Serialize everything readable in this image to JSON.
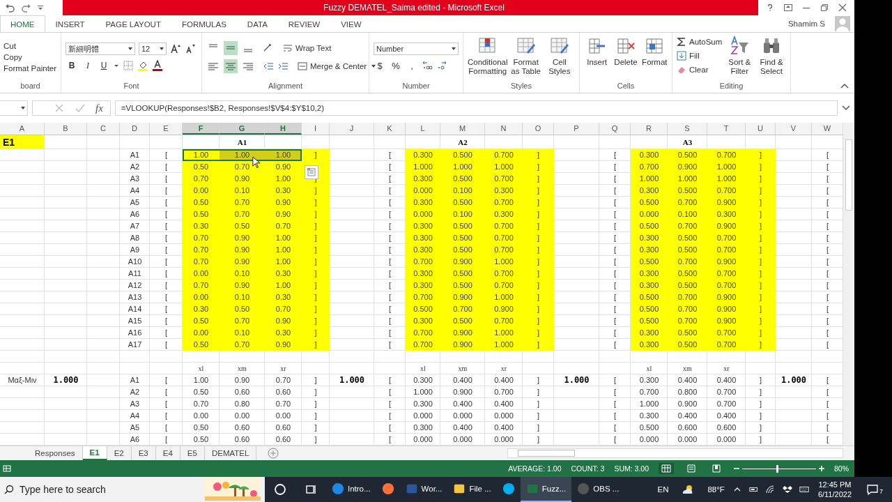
{
  "title_bar": {
    "title": "Fuzzy DEMATEL_Saima edited - Microsoft Excel"
  },
  "ribbon_tabs": [
    {
      "label": "HOME",
      "selected": true
    },
    {
      "label": "INSERT",
      "selected": false
    },
    {
      "label": "PAGE LAYOUT",
      "selected": false
    },
    {
      "label": "FORMULAS",
      "selected": false
    },
    {
      "label": "DATA",
      "selected": false
    },
    {
      "label": "REVIEW",
      "selected": false
    },
    {
      "label": "VIEW",
      "selected": false
    }
  ],
  "account": {
    "name": "Shamim S"
  },
  "ribbon": {
    "clipboard": {
      "label": "board",
      "items": [
        "Cut",
        "Copy",
        "Format Painter"
      ]
    },
    "font": {
      "label": "Font",
      "name": "新細明體",
      "size": "12",
      "styles": [
        "B",
        "I",
        "U"
      ]
    },
    "alignment": {
      "label": "Alignment",
      "vertical": [
        {
          "selected": false
        },
        {
          "selected": true
        },
        {
          "selected": false
        }
      ],
      "horizontal": [
        {
          "selected": false
        },
        {
          "selected": true
        },
        {
          "selected": false
        }
      ],
      "wrap": "Wrap Text",
      "merge": "Merge & Center"
    },
    "number": {
      "label": "Number",
      "format": "Number",
      "symbols": [
        "$",
        "%",
        ","
      ]
    },
    "styles": {
      "label": "Styles",
      "buttons": [
        "Conditional Formatting",
        "Format as Table",
        "Cell Styles"
      ]
    },
    "cells": {
      "label": "Cells",
      "buttons": [
        "Insert",
        "Delete",
        "Format"
      ]
    },
    "editing": {
      "label": "Editing",
      "small": [
        "AutoSum",
        "Fill",
        "Clear"
      ],
      "big": [
        "Sort & Filter",
        "Find & Select"
      ]
    }
  },
  "formula_bar": {
    "fx": "fx",
    "formula": "=VLOOKUP(Responses!$B2, Responses!$V$4:$Y$10,2)"
  },
  "sheet": {
    "columns": [
      {
        "label": "A",
        "band": false,
        "selected": false
      },
      {
        "label": "B",
        "band": false,
        "selected": false
      },
      {
        "label": "C",
        "band": false,
        "selected": false
      },
      {
        "label": "D",
        "band": false,
        "selected": false
      },
      {
        "label": "E",
        "band": false,
        "selected": false
      },
      {
        "label": "F",
        "band": true,
        "selected": true
      },
      {
        "label": "G",
        "band": true,
        "selected": true
      },
      {
        "label": "H",
        "band": true,
        "selected": true
      },
      {
        "label": "I",
        "band": true,
        "selected": false
      },
      {
        "label": "J",
        "band": false,
        "selected": false
      },
      {
        "label": "K",
        "band": false,
        "selected": false
      },
      {
        "label": "L",
        "band": true,
        "selected": false
      },
      {
        "label": "M",
        "band": true,
        "selected": false
      },
      {
        "label": "N",
        "band": true,
        "selected": false
      },
      {
        "label": "O",
        "band": true,
        "selected": false
      },
      {
        "label": "P",
        "band": false,
        "selected": false
      },
      {
        "label": "Q",
        "band": false,
        "selected": false
      },
      {
        "label": "R",
        "band": true,
        "selected": false
      },
      {
        "label": "S",
        "band": true,
        "selected": false
      },
      {
        "label": "T",
        "band": true,
        "selected": false
      },
      {
        "label": "U",
        "band": true,
        "selected": false
      },
      {
        "label": "V",
        "band": false,
        "selected": false
      },
      {
        "label": "W",
        "band": false,
        "selected": false
      }
    ],
    "rows": [
      {
        "kind": "title",
        "selected": false,
        "cells": [
          {
            "text": "E1",
            "filled": true
          },
          null,
          null,
          null,
          null,
          null,
          {
            "text": "A1",
            "filled": false
          },
          null,
          null,
          null,
          null,
          null,
          {
            "text": "A2",
            "filled": false
          },
          null,
          null,
          null,
          null,
          null,
          {
            "text": "A3",
            "filled": false
          },
          null,
          null,
          null,
          null
        ]
      },
      {
        "kind": "data",
        "selected": true,
        "cells": [
          null,
          null,
          null,
          "A1",
          "[",
          "1.00",
          "1.00",
          "1.00",
          "]",
          null,
          "[",
          "0.300",
          "0.500",
          "0.700",
          "]",
          null,
          "[",
          "0.300",
          "0.500",
          "0.700",
          "]",
          null,
          "["
        ]
      },
      {
        "kind": "data",
        "selected": false,
        "cells": [
          null,
          null,
          null,
          "A2",
          "[",
          "0.50",
          "0.70",
          "0.90",
          null,
          null,
          "[",
          "1.000",
          "1.000",
          "1.000",
          "]",
          null,
          "[",
          "0.700",
          "0.900",
          "1.000",
          "]",
          null,
          "["
        ]
      },
      {
        "kind": "data",
        "selected": false,
        "cells": [
          null,
          null,
          null,
          "A3",
          "[",
          "0.70",
          "0.90",
          "1.00",
          "]",
          null,
          "[",
          "0.300",
          "0.500",
          "0.700",
          "]",
          null,
          "[",
          "1.000",
          "1.000",
          "1.000",
          "]",
          null,
          "["
        ]
      },
      {
        "kind": "data",
        "selected": false,
        "cells": [
          null,
          null,
          null,
          "A4",
          "[",
          "0.00",
          "0.10",
          "0.30",
          "]",
          null,
          "[",
          "0.000",
          "0.100",
          "0.300",
          "]",
          null,
          "[",
          "0.300",
          "0.500",
          "0.700",
          "]",
          null,
          "["
        ]
      },
      {
        "kind": "data",
        "selected": false,
        "cells": [
          null,
          null,
          null,
          "A5",
          "[",
          "0.50",
          "0.70",
          "0.90",
          "]",
          null,
          "[",
          "0.300",
          "0.500",
          "0.700",
          "]",
          null,
          "[",
          "0.500",
          "0.700",
          "0.900",
          "]",
          null,
          "["
        ]
      },
      {
        "kind": "data",
        "selected": false,
        "cells": [
          null,
          null,
          null,
          "A6",
          "[",
          "0.50",
          "0.70",
          "0.90",
          "]",
          null,
          "[",
          "0.000",
          "0.100",
          "0.300",
          "]",
          null,
          "[",
          "0.000",
          "0.100",
          "0.300",
          "]",
          null,
          "["
        ]
      },
      {
        "kind": "data",
        "selected": false,
        "cells": [
          null,
          null,
          null,
          "A7",
          "[",
          "0.30",
          "0.50",
          "0.70",
          "]",
          null,
          "[",
          "0.300",
          "0.500",
          "0.700",
          "]",
          null,
          "[",
          "0.500",
          "0.700",
          "0.900",
          "]",
          null,
          "["
        ]
      },
      {
        "kind": "data",
        "selected": false,
        "cells": [
          null,
          null,
          null,
          "A8",
          "[",
          "0.70",
          "0.90",
          "1.00",
          "]",
          null,
          "[",
          "0.300",
          "0.500",
          "0.700",
          "]",
          null,
          "[",
          "0.300",
          "0.500",
          "0.700",
          "]",
          null,
          "["
        ]
      },
      {
        "kind": "data",
        "selected": false,
        "cells": [
          null,
          null,
          null,
          "A9",
          "[",
          "0.70",
          "0.90",
          "1.00",
          "]",
          null,
          "[",
          "0.300",
          "0.500",
          "0.700",
          "]",
          null,
          "[",
          "0.300",
          "0.500",
          "0.700",
          "]",
          null,
          "["
        ]
      },
      {
        "kind": "data",
        "selected": false,
        "cells": [
          null,
          null,
          null,
          "A10",
          "[",
          "0.70",
          "0.90",
          "1.00",
          "]",
          null,
          "[",
          "0.700",
          "0.900",
          "1.000",
          "]",
          null,
          "[",
          "0.500",
          "0.700",
          "0.900",
          "]",
          null,
          "["
        ]
      },
      {
        "kind": "data",
        "selected": false,
        "cells": [
          null,
          null,
          null,
          "A11",
          "[",
          "0.00",
          "0.10",
          "0.30",
          "]",
          null,
          "[",
          "0.300",
          "0.500",
          "0.700",
          "]",
          null,
          "[",
          "0.300",
          "0.500",
          "0.700",
          "]",
          null,
          "["
        ]
      },
      {
        "kind": "data",
        "selected": false,
        "cells": [
          null,
          null,
          null,
          "A12",
          "[",
          "0.70",
          "0.90",
          "1.00",
          "]",
          null,
          "[",
          "0.300",
          "0.500",
          "0.700",
          "]",
          null,
          "[",
          "0.300",
          "0.500",
          "0.700",
          "]",
          null,
          "["
        ]
      },
      {
        "kind": "data",
        "selected": false,
        "cells": [
          null,
          null,
          null,
          "A13",
          "[",
          "0.00",
          "0.10",
          "0.30",
          "]",
          null,
          "[",
          "0.700",
          "0.900",
          "1.000",
          "]",
          null,
          "[",
          "0.500",
          "0.700",
          "0.900",
          "]",
          null,
          "["
        ]
      },
      {
        "kind": "data",
        "selected": false,
        "cells": [
          null,
          null,
          null,
          "A14",
          "[",
          "0.30",
          "0.50",
          "0.70",
          "]",
          null,
          "[",
          "0.500",
          "0.700",
          "0.900",
          "]",
          null,
          "[",
          "0.500",
          "0.700",
          "0.900",
          "]",
          null,
          "["
        ]
      },
      {
        "kind": "data",
        "selected": false,
        "cells": [
          null,
          null,
          null,
          "A15",
          "[",
          "0.50",
          "0.70",
          "0.90",
          "]",
          null,
          "[",
          "0.300",
          "0.500",
          "0.700",
          "]",
          null,
          "[",
          "0.500",
          "0.700",
          "0.900",
          "]",
          null,
          "["
        ]
      },
      {
        "kind": "data",
        "selected": false,
        "cells": [
          null,
          null,
          null,
          "A16",
          "[",
          "0.00",
          "0.10",
          "0.30",
          "]",
          null,
          "[",
          "0.700",
          "0.900",
          "1.000",
          "]",
          null,
          "[",
          "0.300",
          "0.500",
          "0.700",
          "]",
          null,
          "["
        ]
      },
      {
        "kind": "data",
        "selected": false,
        "cells": [
          null,
          null,
          null,
          "A17",
          "[",
          "0.50",
          "0.70",
          "0.90",
          "]",
          null,
          "[",
          "0.700",
          "0.900",
          "1.000",
          "]",
          null,
          "[",
          "0.300",
          "0.500",
          "0.700",
          "]",
          null,
          "["
        ]
      },
      {
        "kind": "blank",
        "selected": false,
        "cells": [
          null,
          null,
          null,
          null,
          null,
          null,
          null,
          null,
          null,
          null,
          null,
          null,
          null,
          null,
          null,
          null,
          null,
          null,
          null,
          null,
          null,
          null,
          null
        ]
      },
      {
        "kind": "header",
        "selected": false,
        "cells": [
          null,
          null,
          null,
          null,
          null,
          "xl",
          "xm",
          "xr",
          null,
          null,
          null,
          "xl",
          "xm",
          "xr",
          null,
          null,
          null,
          "xl",
          "xm",
          "xr",
          null,
          null,
          null
        ]
      },
      {
        "kind": "totals",
        "selected": false,
        "cells": [
          {
            "text": "Mαξ-Mιν",
            "bold": false
          },
          {
            "text": "1.000",
            "bold": true
          },
          null,
          {
            "text": "A1",
            "bold": false
          },
          {
            "text": "[",
            "bold": false
          },
          {
            "text": "1.00",
            "bold": false
          },
          {
            "text": "0.90",
            "bold": false
          },
          {
            "text": "0.70",
            "bold": false
          },
          {
            "text": "]",
            "bold": false
          },
          {
            "text": "1.000",
            "bold": true
          },
          {
            "text": "[",
            "bold": false
          },
          {
            "text": "0.300",
            "bold": false
          },
          {
            "text": "0.400",
            "bold": false
          },
          {
            "text": "0.400",
            "bold": false
          },
          {
            "text": "]",
            "bold": false
          },
          {
            "text": "1.000",
            "bold": true
          },
          {
            "text": "[",
            "bold": false
          },
          {
            "text": "0.300",
            "bold": false
          },
          {
            "text": "0.400",
            "bold": false
          },
          {
            "text": "0.400",
            "bold": false
          },
          {
            "text": "]",
            "bold": false
          },
          {
            "text": "1.000",
            "bold": true
          },
          {
            "text": "[",
            "bold": false
          }
        ]
      },
      {
        "kind": "result",
        "selected": false,
        "cells": [
          null,
          null,
          null,
          "A2",
          "[",
          "0.50",
          "0.60",
          "0.60",
          "]",
          null,
          "[",
          "1.000",
          "0.900",
          "0.700",
          "]",
          null,
          "[",
          "0.700",
          "0.800",
          "0.700",
          "]",
          null,
          "["
        ]
      },
      {
        "kind": "result",
        "selected": false,
        "cells": [
          null,
          null,
          null,
          "A3",
          "[",
          "0.70",
          "0.80",
          "0.70",
          "]",
          null,
          "[",
          "0.300",
          "0.400",
          "0.400",
          "]",
          null,
          "[",
          "1.000",
          "0.900",
          "0.700",
          "]",
          null,
          "["
        ]
      },
      {
        "kind": "result",
        "selected": false,
        "cells": [
          null,
          null,
          null,
          "A4",
          "[",
          "0.00",
          "0.00",
          "0.00",
          "]",
          null,
          "[",
          "0.000",
          "0.000",
          "0.000",
          "]",
          null,
          "[",
          "0.300",
          "0.400",
          "0.400",
          "]",
          null,
          "["
        ]
      },
      {
        "kind": "result",
        "selected": false,
        "cells": [
          null,
          null,
          null,
          "A5",
          "[",
          "0.50",
          "0.60",
          "0.60",
          "]",
          null,
          "[",
          "0.300",
          "0.400",
          "0.400",
          "]",
          null,
          "[",
          "0.500",
          "0.600",
          "0.600",
          "]",
          null,
          "["
        ]
      },
      {
        "kind": "result",
        "selected": false,
        "cells": [
          null,
          null,
          null,
          "A6",
          "[",
          "0.50",
          "0.60",
          "0.60",
          "]",
          null,
          "[",
          "0.000",
          "0.000",
          "0.000",
          "]",
          null,
          "[",
          "0.000",
          "0.000",
          "0.000",
          "]",
          null,
          "["
        ]
      }
    ]
  },
  "sheet_tabs": [
    {
      "label": "Responses",
      "selected": false
    },
    {
      "label": "E1",
      "selected": true
    },
    {
      "label": "E2",
      "selected": false
    },
    {
      "label": "E3",
      "selected": false
    },
    {
      "label": "E4",
      "selected": false
    },
    {
      "label": "E5",
      "selected": false
    },
    {
      "label": "DEMATEL",
      "selected": false
    }
  ],
  "status_bar": {
    "average": "AVERAGE: 1.00",
    "count": "COUNT: 3",
    "sum": "SUM: 3.00",
    "zoom": {
      "level": 0.47,
      "label": "80%"
    }
  },
  "taskbar": {
    "search_placeholder": "Type here to search",
    "apps": [
      {
        "label": "Intro...",
        "selected": false
      },
      {
        "selected": false
      },
      {
        "label": "Wor...",
        "selected": false
      },
      {
        "label": "File ...",
        "selected": false
      },
      {
        "selected": false
      },
      {
        "label": "Fuzz...",
        "selected": true
      },
      {
        "label": "OBS ...",
        "selected": false
      }
    ],
    "tray": {
      "language": "EN",
      "weather": "88°F",
      "time": "12:45 PM",
      "date": "6/11/2022",
      "notifications": "7"
    }
  }
}
